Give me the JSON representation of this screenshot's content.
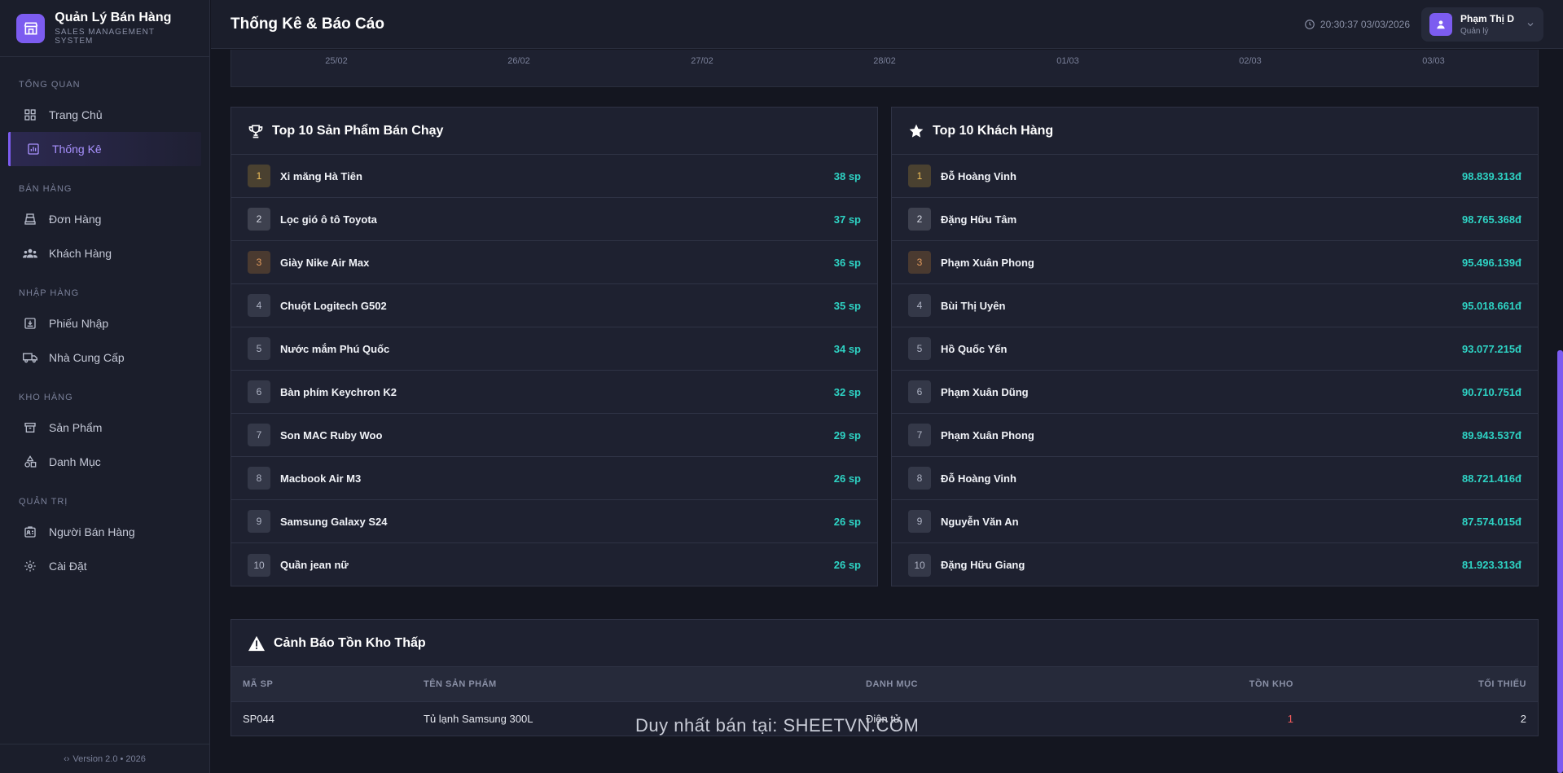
{
  "app": {
    "title": "Quản Lý Bán Hàng",
    "subtitle": "SALES MANAGEMENT SYSTEM",
    "version": "Version 2.0 • 2026"
  },
  "sidebar": {
    "sections": [
      {
        "label": "TỔNG QUAN",
        "items": [
          {
            "label": "Trang Chủ",
            "icon": "grid-icon"
          },
          {
            "label": "Thống Kê",
            "icon": "chart-icon",
            "active": true
          }
        ]
      },
      {
        "label": "BÁN HÀNG",
        "items": [
          {
            "label": "Đơn Hàng",
            "icon": "register-icon"
          },
          {
            "label": "Khách Hàng",
            "icon": "users-icon"
          }
        ]
      },
      {
        "label": "NHẬP HÀNG",
        "items": [
          {
            "label": "Phiếu Nhập",
            "icon": "import-icon"
          },
          {
            "label": "Nhà Cung Cấp",
            "icon": "truck-icon"
          }
        ]
      },
      {
        "label": "KHO HÀNG",
        "items": [
          {
            "label": "Sản Phẩm",
            "icon": "archive-icon"
          },
          {
            "label": "Danh Mục",
            "icon": "shapes-icon"
          }
        ]
      },
      {
        "label": "QUẢN TRỊ",
        "items": [
          {
            "label": "Người Bán Hàng",
            "icon": "id-card-icon"
          },
          {
            "label": "Cài Đặt",
            "icon": "gear-icon"
          }
        ]
      }
    ]
  },
  "header": {
    "title": "Thống Kê & Báo Cáo",
    "clock": "20:30:37 03/03/2026",
    "user_name": "Phạm Thị D",
    "user_role": "Quản lý"
  },
  "chart_axis": {
    "ticks": [
      "25/02",
      "26/02",
      "27/02",
      "28/02",
      "01/03",
      "02/03",
      "03/03"
    ]
  },
  "top_products": {
    "title": "Top 10 Sản Phẩm Bán Chạy",
    "rows": [
      {
        "rank": "1",
        "name": "Xi măng Hà Tiên",
        "value": "38 sp"
      },
      {
        "rank": "2",
        "name": "Lọc gió ô tô Toyota",
        "value": "37 sp"
      },
      {
        "rank": "3",
        "name": "Giày Nike Air Max",
        "value": "36 sp"
      },
      {
        "rank": "4",
        "name": "Chuột Logitech G502",
        "value": "35 sp"
      },
      {
        "rank": "5",
        "name": "Nước mắm Phú Quốc",
        "value": "34 sp"
      },
      {
        "rank": "6",
        "name": "Bàn phím Keychron K2",
        "value": "32 sp"
      },
      {
        "rank": "7",
        "name": "Son MAC Ruby Woo",
        "value": "29 sp"
      },
      {
        "rank": "8",
        "name": "Macbook Air M3",
        "value": "26 sp"
      },
      {
        "rank": "9",
        "name": "Samsung Galaxy S24",
        "value": "26 sp"
      },
      {
        "rank": "10",
        "name": "Quần jean nữ",
        "value": "26 sp"
      }
    ]
  },
  "top_customers": {
    "title": "Top 10 Khách Hàng",
    "rows": [
      {
        "rank": "1",
        "name": "Đỗ Hoàng Vinh",
        "value": "98.839.313đ"
      },
      {
        "rank": "2",
        "name": "Đặng Hữu Tâm",
        "value": "98.765.368đ"
      },
      {
        "rank": "3",
        "name": "Phạm Xuân Phong",
        "value": "95.496.139đ"
      },
      {
        "rank": "4",
        "name": "Bùi Thị Uyên",
        "value": "95.018.661đ"
      },
      {
        "rank": "5",
        "name": "Hồ Quốc Yến",
        "value": "93.077.215đ"
      },
      {
        "rank": "6",
        "name": "Phạm Xuân Dũng",
        "value": "90.710.751đ"
      },
      {
        "rank": "7",
        "name": "Phạm Xuân Phong",
        "value": "89.943.537đ"
      },
      {
        "rank": "8",
        "name": "Đỗ Hoàng Vinh",
        "value": "88.721.416đ"
      },
      {
        "rank": "9",
        "name": "Nguyễn Văn An",
        "value": "87.574.015đ"
      },
      {
        "rank": "10",
        "name": "Đặng Hữu Giang",
        "value": "81.923.313đ"
      }
    ]
  },
  "low_stock": {
    "title": "Cảnh Báo Tồn Kho Thấp",
    "columns": [
      "MÃ SP",
      "TÊN SẢN PHẨM",
      "DANH MỤC",
      "TỒN KHO",
      "TỐI THIỂU"
    ],
    "rows": [
      {
        "code": "SP044",
        "name": "Tủ lạnh Samsung 300L",
        "category": "Điện tử",
        "stock": "1",
        "min": "2"
      }
    ]
  },
  "watermark": "Duy nhất bán tại: SHEETVN.COM",
  "colors": {
    "accent": "#7c5cf0",
    "value": "#2ed3c4",
    "danger": "#f25c5c",
    "gold": "#f3c15a",
    "bronze": "#e29a5d"
  }
}
